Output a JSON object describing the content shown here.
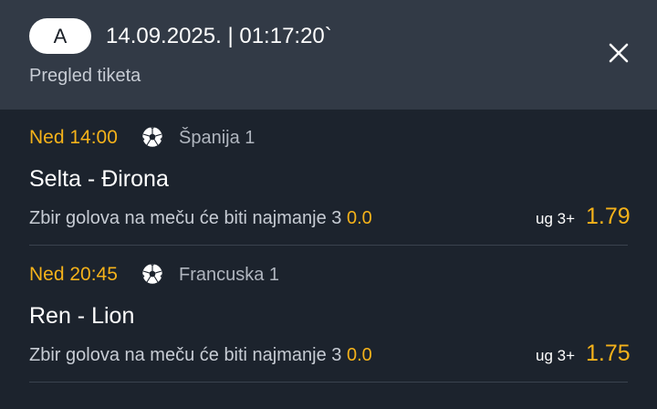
{
  "header": {
    "badge": "A",
    "datetime": "14.09.2025. | 01:17:20`",
    "subtitle": "Pregled tiketa",
    "close_icon": "close-icon"
  },
  "matches": [
    {
      "time": "Ned 14:00",
      "sport_icon": "soccer-ball-icon",
      "league": "Španija  1",
      "teams": "Selta - Đirona",
      "description": "Zbir golova na meču će biti najmanje 3",
      "value": "0.0",
      "tip": "ug 3+",
      "odds": "1.79"
    },
    {
      "time": "Ned 20:45",
      "sport_icon": "soccer-ball-icon",
      "league": "Francuska  1",
      "teams": "Ren - Lion",
      "description": "Zbir golova na meču će biti najmanje 3",
      "value": "0.0",
      "tip": "ug 3+",
      "odds": "1.75"
    }
  ],
  "colors": {
    "background": "#1c232d",
    "header": "#323a46",
    "accent": "#f5b21a"
  }
}
